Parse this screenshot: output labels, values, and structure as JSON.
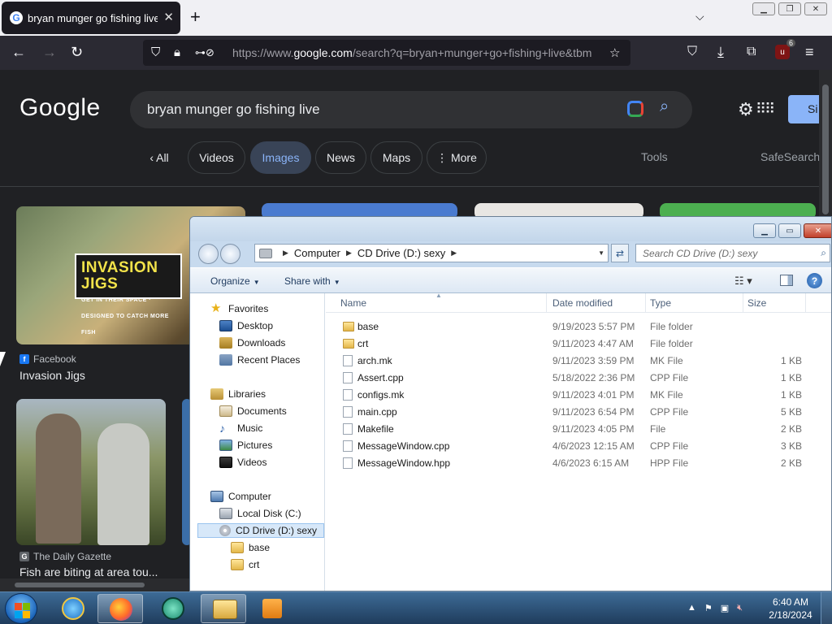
{
  "browser": {
    "tab_title": "bryan munger go fishing live - G",
    "tab_favicon": "G",
    "url_prefix": "https://www.",
    "url_domain": "google.com",
    "url_rest": "/search?q=bryan+munger+go+fishing+live&tbm",
    "extension_badge": "6"
  },
  "google": {
    "logo": "Google",
    "query": "bryan munger go fishing live",
    "signin": "Si",
    "chips": [
      {
        "label": "‹  All"
      },
      {
        "label": "Videos"
      },
      {
        "label": "Images"
      },
      {
        "label": "News"
      },
      {
        "label": "Maps"
      },
      {
        "label": "⋮ More"
      }
    ],
    "tools": "Tools",
    "safesearch": "SafeSearch",
    "results": [
      {
        "source": "Facebook",
        "caption": "Invasion Jigs",
        "brand_line1": "INVASION JIGS",
        "brand_line2": "GET IN THEIR SPACE · DESIGNED TO CATCH MORE FISH"
      },
      {
        "source": "The Daily Gazette",
        "caption": "Fish are biting at area tou..."
      }
    ]
  },
  "explorer": {
    "breadcrumb": [
      "Computer",
      "CD Drive (D:) sexy"
    ],
    "search_placeholder": "Search CD Drive (D:) sexy",
    "organize": "Organize",
    "share_with": "Share with",
    "columns": {
      "name": "Name",
      "date": "Date modified",
      "type": "Type",
      "size": "Size"
    },
    "nav": {
      "favorites": "Favorites",
      "desktop": "Desktop",
      "downloads": "Downloads",
      "recent": "Recent Places",
      "libraries": "Libraries",
      "documents": "Documents",
      "music": "Music",
      "pictures": "Pictures",
      "videos": "Videos",
      "computer": "Computer",
      "local_disk": "Local Disk (C:)",
      "cd_drive": "CD Drive (D:) sexy",
      "base": "base",
      "crt": "crt"
    },
    "files": [
      {
        "name": "base",
        "date": "9/19/2023 5:57 PM",
        "type": "File folder",
        "size": ""
      },
      {
        "name": "crt",
        "date": "9/11/2023 4:47 AM",
        "type": "File folder",
        "size": ""
      },
      {
        "name": "arch.mk",
        "date": "9/11/2023 3:59 PM",
        "type": "MK File",
        "size": "1 KB"
      },
      {
        "name": "Assert.cpp",
        "date": "5/18/2022 2:36 PM",
        "type": "CPP File",
        "size": "1 KB"
      },
      {
        "name": "configs.mk",
        "date": "9/11/2023 4:01 PM",
        "type": "MK File",
        "size": "1 KB"
      },
      {
        "name": "main.cpp",
        "date": "9/11/2023 6:54 PM",
        "type": "CPP File",
        "size": "5 KB"
      },
      {
        "name": "Makefile",
        "date": "9/11/2023 4:05 PM",
        "type": "File",
        "size": "2 KB"
      },
      {
        "name": "MessageWindow.cpp",
        "date": "4/6/2023 12:15 AM",
        "type": "CPP File",
        "size": "3 KB"
      },
      {
        "name": "MessageWindow.hpp",
        "date": "4/6/2023 6:15 AM",
        "type": "HPP File",
        "size": "2 KB"
      }
    ]
  },
  "taskbar": {
    "time": "6:40 AM",
    "date": "2/18/2024"
  },
  "colors": {
    "google_bg": "#202124",
    "chip_active": "#394457",
    "link_blue": "#8ab4f8",
    "explorer_chrome": "#cfe0f1",
    "taskbar": "#1f3c5c"
  }
}
